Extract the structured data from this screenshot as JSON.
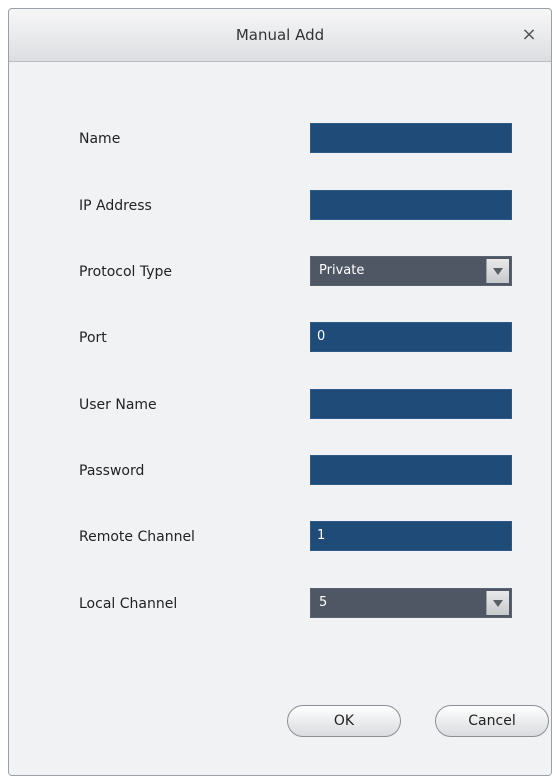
{
  "dialog": {
    "title": "Manual Add",
    "close_symbol": "×"
  },
  "form": {
    "name": {
      "label": "Name",
      "value": ""
    },
    "ip_address": {
      "label": "IP Address",
      "value": ""
    },
    "protocol_type": {
      "label": "Protocol Type",
      "value": "Private"
    },
    "port": {
      "label": "Port",
      "value": "0"
    },
    "user_name": {
      "label": "User Name",
      "value": ""
    },
    "password": {
      "label": "Password",
      "value": ""
    },
    "remote_channel": {
      "label": "Remote Channel",
      "value": "1"
    },
    "local_channel": {
      "label": "Local Channel",
      "value": "5"
    }
  },
  "buttons": {
    "ok": "OK",
    "cancel": "Cancel"
  },
  "colors": {
    "field_background": "#1f4b78",
    "select_background": "#4f5764",
    "dialog_background": "#f1f2f4"
  },
  "icons": {
    "close": "close-icon",
    "dropdown": "chevron-down-icon"
  }
}
